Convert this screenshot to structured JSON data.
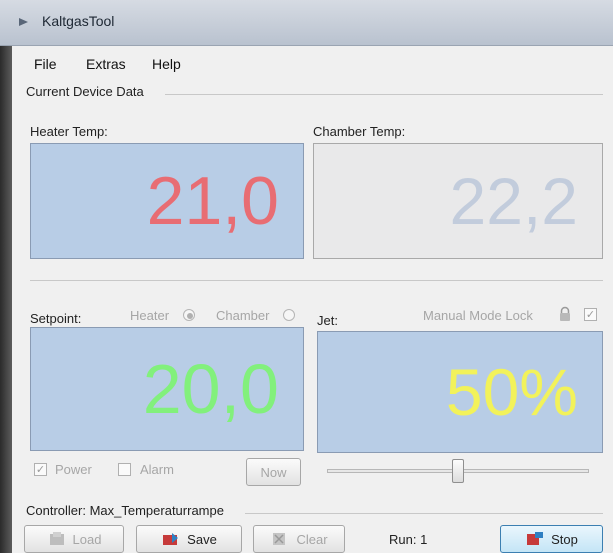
{
  "window": {
    "title": "KaltgasTool"
  },
  "menu": [
    "File",
    "Extras",
    "Help"
  ],
  "section": {
    "label": "Current Device Data"
  },
  "heater": {
    "label": "Heater Temp:",
    "value": "21,0"
  },
  "chamber": {
    "label": "Chamber Temp:",
    "value": "22,2"
  },
  "setpoint": {
    "label": "Setpoint:",
    "value": "20,0",
    "radio_heater": "Heater",
    "radio_chamber": "Chamber",
    "selected": "Heater"
  },
  "jet": {
    "label": "Jet:",
    "value": "50%",
    "manual_mode_lock": "Manual Mode Lock",
    "slider_level": 0.5
  },
  "options": {
    "power": "Power",
    "power_checked": true,
    "alarm": "Alarm",
    "alarm_checked": false,
    "now": "Now"
  },
  "controller": {
    "text": "Controller: Max_Temperaturrampe"
  },
  "buttons": {
    "load": "Load",
    "save": "Save",
    "clear": "Clear",
    "stop": "Stop"
  },
  "run": {
    "text": "Run: 1"
  },
  "colors": {
    "display_bg": "#b8cde6",
    "heater_value": "#e86d73",
    "chamber_value": "#c2ccdc",
    "setpoint_value": "#82f07c",
    "jet_value": "#f2f25a"
  }
}
